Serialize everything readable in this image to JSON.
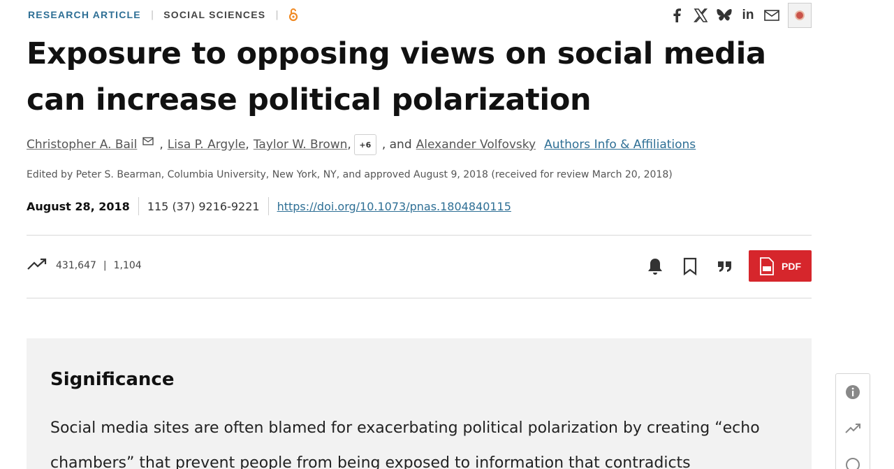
{
  "header": {
    "article_type": "RESEARCH ARTICLE",
    "section": "SOCIAL SCIENCES",
    "separator": "|",
    "share_icons": [
      "facebook-icon",
      "x-icon",
      "bluesky-icon",
      "linkedin-icon",
      "email-icon"
    ],
    "share_linkedin_text": "in",
    "open_access_icon": "open-access-icon"
  },
  "article": {
    "title": "Exposure to opposing views on social media can increase political polarization",
    "authors": [
      "Christopher A. Bail",
      "Lisa P. Argyle",
      "Taylor W. Brown",
      "Alexander Volfovsky"
    ],
    "comma": ",",
    "more_authors": "+6",
    "and_text": ", and",
    "affiliations_link": "Authors Info & Affiliations",
    "edited_by": "Edited by Peter S. Bearman, Columbia University, New York, NY, and approved August 9, 2018 (received for review March 20, 2018)",
    "date": "August 28, 2018",
    "citation": "115 (37) 9216-9221",
    "doi": "https://doi.org/10.1073/pnas.1804840115"
  },
  "metrics": {
    "views": "431,647",
    "separator": "|",
    "citations": "1,104"
  },
  "toolbar": {
    "pdf_label": "PDF"
  },
  "significance": {
    "heading": "Significance",
    "text": "Social media sites are often blamed for exacerbating political polarization by creating “echo chambers” that prevent people from being exposed to information that contradicts"
  },
  "colors": {
    "accent": "#2e6f95",
    "pdf_red": "#d6262c",
    "panel_bg": "#f2f2f2"
  }
}
